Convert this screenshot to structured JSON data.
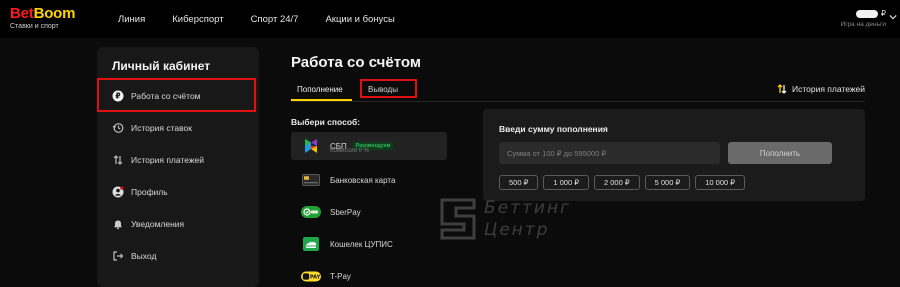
{
  "header": {
    "logo_part1": "Bet",
    "logo_part2": "Boom",
    "logo_sub": "Ставки и спорт",
    "nav": [
      "Линия",
      "Киберспорт",
      "Спорт 24/7",
      "Акции и бонусы"
    ],
    "currency": "₽",
    "balance_sub": "Игра на деньги"
  },
  "sidebar": {
    "title": "Личный кабинет",
    "items": [
      {
        "label": "Работа со счётом",
        "icon": "ruble-icon"
      },
      {
        "label": "История ставок",
        "icon": "history-icon"
      },
      {
        "label": "История платежей",
        "icon": "transfer-icon"
      },
      {
        "label": "Профиль",
        "icon": "profile-icon"
      },
      {
        "label": "Уведомления",
        "icon": "bell-icon"
      },
      {
        "label": "Выход",
        "icon": "logout-icon"
      }
    ]
  },
  "main": {
    "title": "Работа со счётом",
    "tabs": [
      "Пополнение",
      "Выводы"
    ],
    "history_link": "История платежей",
    "methods_label": "Выбери способ:",
    "methods": [
      {
        "name": "СБП",
        "badge": "Рекомендуем",
        "fee": "Комиссия 0 %"
      },
      {
        "name": "Банковская карта"
      },
      {
        "name": "SberPay"
      },
      {
        "name": "Кошелек ЦУПИС"
      },
      {
        "name": "T-Pay"
      }
    ],
    "panel": {
      "title": "Введи сумму пополнения",
      "placeholder": "Сумма от 100 ₽ до 595000 ₽",
      "button": "Пополнить",
      "chips": [
        "500 ₽",
        "1 000 ₽",
        "2 000 ₽",
        "5 000 ₽",
        "10 000 ₽"
      ]
    }
  },
  "watermark": {
    "line1": "Беттинг",
    "line2": "Центр"
  },
  "colors": {
    "accent_yellow": "#ffd400",
    "brand_red": "#ff1a1a",
    "highlight_red": "#e01010"
  }
}
